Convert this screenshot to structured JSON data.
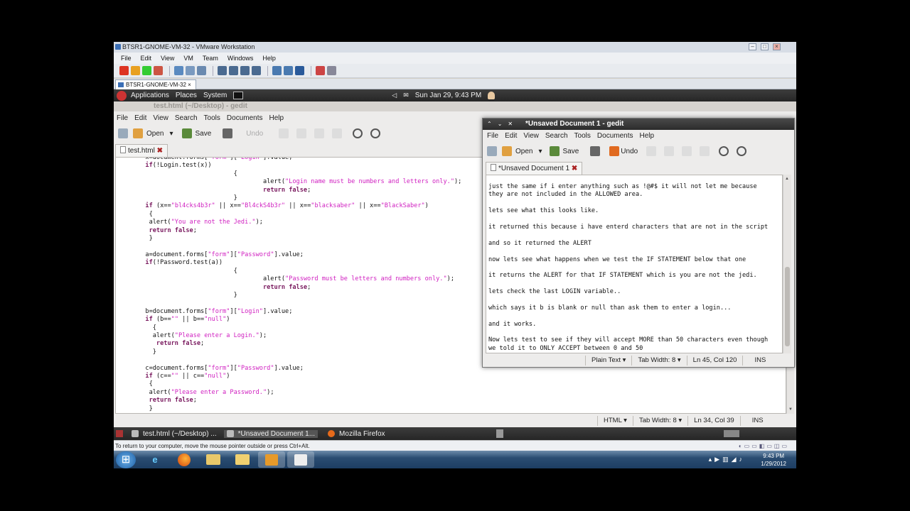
{
  "vmware": {
    "title": "BTSR1-GNOME-VM-32 - VMware Workstation",
    "menu": [
      "File",
      "Edit",
      "View",
      "VM",
      "Team",
      "Windows",
      "Help"
    ],
    "tab": "BTSR1-GNOME-VM-32",
    "status_text": "To return to your computer, move the mouse pointer outside or press Ctrl+Alt."
  },
  "gnome_panel": {
    "apps": "Applications",
    "places": "Places",
    "system": "System",
    "datetime": "Sun Jan 29,  9:43 PM"
  },
  "gedit1": {
    "title": "test.html (~/Desktop) - gedit",
    "menu": [
      "File",
      "Edit",
      "View",
      "Search",
      "Tools",
      "Documents",
      "Help"
    ],
    "toolbar": {
      "open": "Open",
      "save": "Save",
      "undo": "Undo"
    },
    "tab": "test.html",
    "code": [
      "        x=document.forms[\"form\"][\"Login\"].value;",
      "        if(!Login.test(x))",
      "                                {",
      "                                        alert(\"Login name must be numbers and letters only.\");",
      "                                        return false;",
      "                                }",
      "        if (x==\"bl4cks4b3r\" || x==\"Bl4ckS4b3r\" || x==\"blacksaber\" || x==\"BlackSaber\")",
      "         {",
      "         alert(\"You are not the Jedi.\");",
      "         return false;",
      "         }",
      "",
      "        a=document.forms[\"form\"][\"Password\"].value;",
      "        if(!Password.test(a))",
      "                                {",
      "                                        alert(\"Password must be letters and numbers only.\");",
      "                                        return false;",
      "                                }",
      "",
      "        b=document.forms[\"form\"][\"Login\"].value;",
      "        if (b==\"\" || b==\"null\")",
      "          {",
      "          alert(\"Please enter a Login.\");",
      "           return false;",
      "          }",
      "",
      "        c=document.forms[\"form\"][\"Password\"].value;",
      "        if (c==\"\" || c==\"null\")",
      "         {",
      "         alert(\"Please enter a Password.\");",
      "         return false;",
      "         }"
    ],
    "status": {
      "lang": "HTML",
      "tab_width": "Tab Width:  8",
      "position": "Ln 34, Col 39",
      "mode": "INS"
    }
  },
  "gedit2": {
    "title": "*Unsaved Document 1 - gedit",
    "menu": [
      "File",
      "Edit",
      "View",
      "Search",
      "Tools",
      "Documents",
      "Help"
    ],
    "toolbar": {
      "open": "Open",
      "save": "Save",
      "undo": "Undo"
    },
    "tab": "*Unsaved Document 1",
    "lines": [
      "just the same if i enter anything such as !@#$ it will not let me because",
      "they are not included in the ALLOWED area.",
      "",
      "lets see what this looks like.",
      "",
      "it returned this because i have enterd characters that are not in the script",
      "",
      "and so it returned the ALERT",
      "",
      "now lets see what happens when we test the IF STATEMENT below that one",
      "",
      "it returns the ALERT for that IF STATEMENT which is you are not the jedi.",
      "",
      "lets check the last LOGIN variable..",
      "",
      "which says it b is blank or null than ask them to enter a login...",
      "",
      "and it works.",
      "",
      "Now lets test to see if they will accept MORE than 50 characters even though",
      "we told it to ONLY ACCEPT between 0 and 50"
    ],
    "status": {
      "lang": "Plain Text",
      "tab_width": "Tab Width:  8",
      "position": "Ln 45, Col 120",
      "mode": "INS"
    }
  },
  "gnome_taskbar": [
    "test.html (~/Desktop) ...",
    "*Unsaved Document 1...",
    "Mozilla Firefox"
  ],
  "windows": {
    "time": "9:43 PM",
    "date": "1/29/2012"
  }
}
